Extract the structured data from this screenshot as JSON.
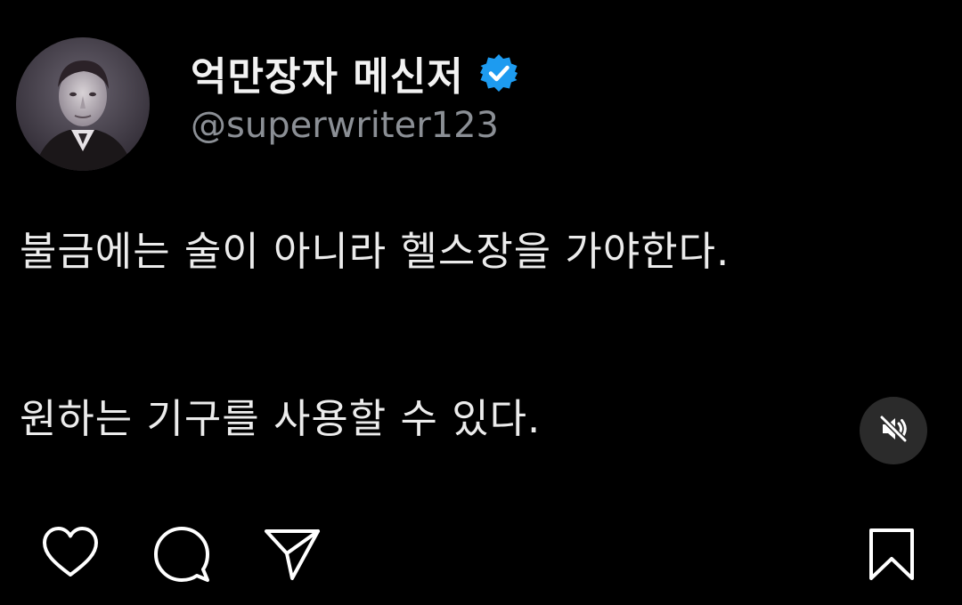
{
  "post": {
    "author": {
      "display_name": "억만장자 메신저",
      "handle": "@superwriter123",
      "verified": true
    },
    "text_lines": [
      "불금에는 술이 아니라 헬스장을 가야한다.",
      "원하는 기구를 사용할 수 있다."
    ]
  },
  "controls": {
    "mute_icon": "speaker-muted-icon"
  },
  "actions": {
    "like_icon": "heart-icon",
    "comment_icon": "comment-icon",
    "share_icon": "paper-plane-icon",
    "save_icon": "bookmark-icon"
  },
  "colors": {
    "background": "#000000",
    "text": "#ececec",
    "handle": "#8b8f95",
    "verified": "#1d9bf0",
    "mute_bg": "#2b2b2b"
  }
}
